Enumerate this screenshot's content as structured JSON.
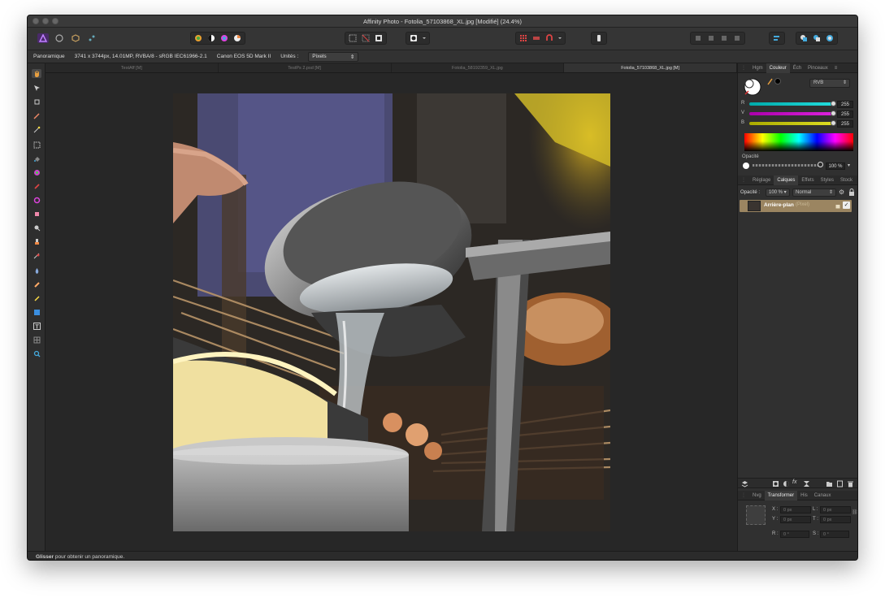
{
  "window": {
    "title": "Affinity Photo - Fotolia_57103868_XL.jpg [Modifié] (24.4%)"
  },
  "context_bar": {
    "tool_name": "Panoramique",
    "image_info": "3741 x 3744px, 14.01MP, RVBA/8 - sRGB IEC61966-2.1",
    "camera": "Canon EOS 5D Mark II",
    "units_label": "Unités :",
    "units_value": "Pixels"
  },
  "doc_tabs": [
    "TestAff [M]",
    "TestPs 2.psd [M]",
    "Fotolia_58192359_XL.jpg",
    "Fotolia_57103868_XL.jpg [M]"
  ],
  "right_panel": {
    "top_tabs": [
      "Hgm",
      "Couleur",
      "Éch",
      "Pinceaux"
    ],
    "color_model": "RVB",
    "channels": [
      {
        "label": "R",
        "value": "255",
        "color": "#2ad6d6"
      },
      {
        "label": "V",
        "value": "255",
        "color": "#d628d6"
      },
      {
        "label": "B",
        "value": "255",
        "color": "#d6d628"
      }
    ],
    "opacity_label": "Opacité",
    "opacity_value": "100 %",
    "layer_tabs": [
      "Réglage",
      "Calques",
      "Effets",
      "Styles",
      "Stock"
    ],
    "layers_opacity_label": "Opacité :",
    "layers_opacity_value": "100 %",
    "blend_mode": "Normal",
    "layer": {
      "name": "Arrière-plan",
      "type": "(Pixel)"
    },
    "bottom_tabs": [
      "Nvg",
      "Transformer",
      "His",
      "Canaux"
    ],
    "transform": {
      "x_label": "X :",
      "x_value": "0 px",
      "y_label": "Y :",
      "y_value": "0 px",
      "w_label": "L :",
      "w_value": "0 px",
      "h_label": "T :",
      "h_value": "0 px",
      "r_label": "R :",
      "r_value": "0 °",
      "s_label": "S :",
      "s_value": "0 °"
    }
  },
  "status": {
    "bold": "Glisser",
    "text": " pour obtenir un panoramique."
  },
  "colors": {
    "accent": "#7a6a4a",
    "layer_selected": "#9b8561"
  }
}
